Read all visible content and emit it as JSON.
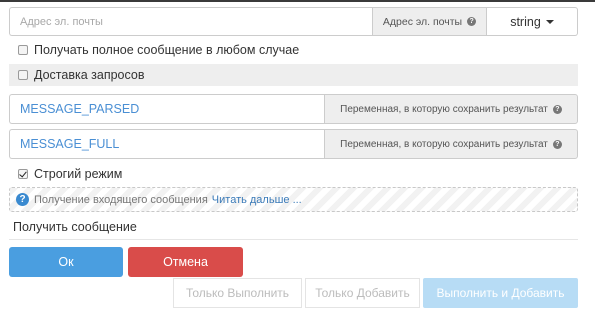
{
  "email": {
    "placeholder": "Адрес эл. почты",
    "addon_label": "Адрес эл. почты",
    "type_value": "string"
  },
  "options": {
    "full_message_label": "Получать полное сообщение в любом случае",
    "full_message_checked": false,
    "delivery_label": "Доставка запросов",
    "delivery_checked": false,
    "strict_label": "Строгий режим",
    "strict_checked": true
  },
  "variables": [
    {
      "value": "MESSAGE_PARSED",
      "addon_label": "Переменная, в которую сохранить результат"
    },
    {
      "value": "MESSAGE_FULL",
      "addon_label": "Переменная, в которую сохранить результат"
    }
  ],
  "info": {
    "text": "Получение входящего сообщения",
    "link_label": "Читать дальше ..."
  },
  "section_title": "Получить сообщение",
  "buttons": {
    "ok": "Ок",
    "cancel": "Отмена",
    "execute_only": "Только Выполнить",
    "add_only": "Только Добавить",
    "execute_and_add": "Выполнить и Добавить"
  },
  "colors": {
    "primary": "#4a9ee0",
    "danger": "#d94c4a",
    "variable_text": "#4a8fd4",
    "link": "#3a7ab8",
    "disabled_primary": "#b7dcf5"
  },
  "icons": {
    "help": "question-circle",
    "info": "info-question-circle"
  }
}
